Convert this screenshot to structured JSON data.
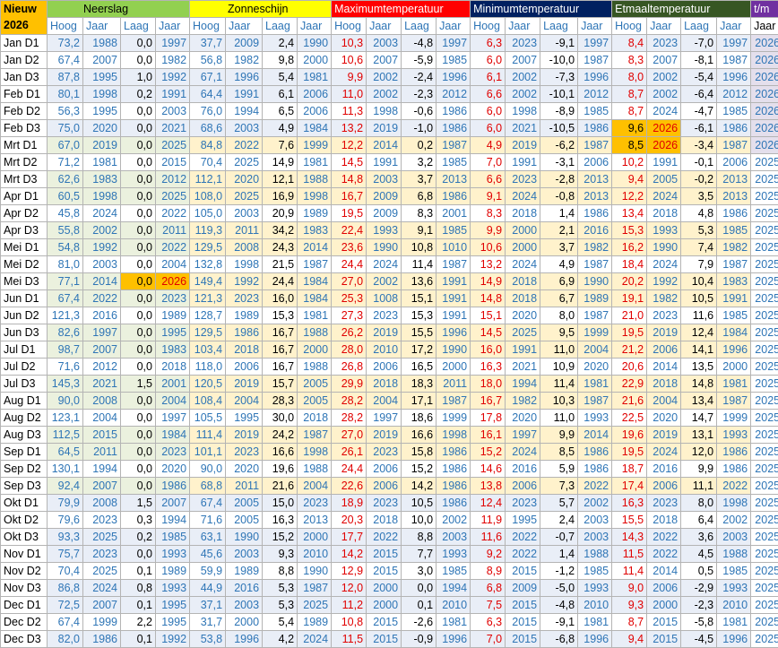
{
  "corner": {
    "line1": "Nieuw",
    "line2": "2026"
  },
  "groups": {
    "neerslag": "Neerslag",
    "zonneschijn": "Zonneschijn",
    "maxtemp": "Maximumtemperatuur",
    "mintemp": "Minimumtemperatuur",
    "etmaal": "Etmaaltemperatuur",
    "tm": "t/m"
  },
  "subheaders": [
    "Hoog",
    "Jaar",
    "Laag",
    "Jaar",
    "Hoog",
    "Jaar",
    "Laag",
    "Jaar",
    "Hoog",
    "Jaar",
    "Laag",
    "Jaar",
    "Hoog",
    "Jaar",
    "Laag",
    "Jaar",
    "Hoog",
    "Jaar",
    "Laag",
    "Jaar",
    "Jaar"
  ],
  "colors": {
    "highlight": "#ffc000",
    "blue_text": "#2e75b6",
    "red_text": "#e00000",
    "neerslag": "#92d050",
    "zon": "#ffff00",
    "max": "#ff0000",
    "min": "#002060",
    "etmaal": "#375623",
    "tm": "#7030a0"
  },
  "rows": [
    {
      "label": "Jan D1",
      "v": [
        "73,2",
        "1988",
        "0,0",
        "1997",
        "37,7",
        "2009",
        "2,4",
        "1990",
        "10,3",
        "2003",
        "-4,8",
        "1997",
        "6,3",
        "2023",
        "-9,1",
        "1997",
        "8,4",
        "2023",
        "-7,0",
        "1997",
        "2026"
      ]
    },
    {
      "label": "Jan D2",
      "v": [
        "67,4",
        "2007",
        "0,0",
        "1982",
        "56,8",
        "1982",
        "9,8",
        "2000",
        "10,6",
        "2007",
        "-5,9",
        "1985",
        "6,0",
        "2007",
        "-10,0",
        "1987",
        "8,3",
        "2007",
        "-8,1",
        "1987",
        "2026"
      ]
    },
    {
      "label": "Jan D3",
      "v": [
        "87,8",
        "1995",
        "1,0",
        "1992",
        "67,1",
        "1996",
        "5,4",
        "1981",
        "9,9",
        "2002",
        "-2,4",
        "1996",
        "6,1",
        "2002",
        "-7,3",
        "1996",
        "8,0",
        "2002",
        "-5,4",
        "1996",
        "2026"
      ]
    },
    {
      "label": "Feb D1",
      "v": [
        "80,1",
        "1998",
        "0,2",
        "1991",
        "64,4",
        "1991",
        "6,1",
        "2006",
        "11,0",
        "2002",
        "-2,3",
        "2012",
        "6,6",
        "2002",
        "-10,1",
        "2012",
        "8,7",
        "2002",
        "-6,4",
        "2012",
        "2026"
      ]
    },
    {
      "label": "Feb D2",
      "v": [
        "56,3",
        "1995",
        "0,0",
        "2003",
        "76,0",
        "1994",
        "6,5",
        "2006",
        "11,3",
        "1998",
        "-0,6",
        "1986",
        "6,0",
        "1998",
        "-8,9",
        "1985",
        "8,7",
        "2024",
        "-4,7",
        "1985",
        "2026"
      ]
    },
    {
      "label": "Feb D3",
      "v": [
        "75,0",
        "2020",
        "0,0",
        "2021",
        "68,6",
        "2003",
        "4,9",
        "1984",
        "13,2",
        "2019",
        "-1,0",
        "1986",
        "6,0",
        "2021",
        "-10,5",
        "1986",
        "9,6",
        "2026",
        "-6,1",
        "1986",
        "2026"
      ]
    },
    {
      "label": "Mrt D1",
      "v": [
        "67,0",
        "2019",
        "0,0",
        "2025",
        "84,8",
        "2022",
        "7,6",
        "1999",
        "12,2",
        "2014",
        "0,2",
        "1987",
        "4,9",
        "2019",
        "-6,2",
        "1987",
        "8,5",
        "2026",
        "-3,4",
        "1987",
        "2026"
      ]
    },
    {
      "label": "Mrt D2",
      "v": [
        "71,2",
        "1981",
        "0,0",
        "2015",
        "70,4",
        "2025",
        "14,9",
        "1981",
        "14,5",
        "1991",
        "3,2",
        "1985",
        "7,0",
        "1991",
        "-3,1",
        "2006",
        "10,2",
        "1991",
        "-0,1",
        "2006",
        "2025"
      ]
    },
    {
      "label": "Mrt D3",
      "v": [
        "62,6",
        "1983",
        "0,0",
        "2012",
        "112,1",
        "2020",
        "12,1",
        "1988",
        "14,8",
        "2003",
        "3,7",
        "2013",
        "6,6",
        "2023",
        "-2,8",
        "2013",
        "9,4",
        "2005",
        "-0,2",
        "2013",
        "2025"
      ]
    },
    {
      "label": "Apr D1",
      "v": [
        "60,5",
        "1998",
        "0,0",
        "2025",
        "108,0",
        "2025",
        "16,9",
        "1998",
        "16,7",
        "2009",
        "6,8",
        "1986",
        "9,1",
        "2024",
        "-0,8",
        "2013",
        "12,2",
        "2024",
        "3,5",
        "2013",
        "2025"
      ]
    },
    {
      "label": "Apr D2",
      "v": [
        "45,8",
        "2024",
        "0,0",
        "2022",
        "105,0",
        "2003",
        "20,9",
        "1989",
        "19,5",
        "2009",
        "8,3",
        "2001",
        "8,3",
        "2018",
        "1,4",
        "1986",
        "13,4",
        "2018",
        "4,8",
        "1986",
        "2025"
      ]
    },
    {
      "label": "Apr D3",
      "v": [
        "55,8",
        "2002",
        "0,0",
        "2011",
        "119,3",
        "2011",
        "34,2",
        "1983",
        "22,4",
        "1993",
        "9,1",
        "1985",
        "9,9",
        "2000",
        "2,1",
        "2016",
        "15,3",
        "1993",
        "5,3",
        "1985",
        "2025"
      ]
    },
    {
      "label": "Mei D1",
      "v": [
        "54,8",
        "1992",
        "0,0",
        "2022",
        "129,5",
        "2008",
        "24,3",
        "2014",
        "23,6",
        "1990",
        "10,8",
        "1010",
        "10,6",
        "2000",
        "3,7",
        "1982",
        "16,2",
        "1990",
        "7,4",
        "1982",
        "2025"
      ]
    },
    {
      "label": "Mei D2",
      "v": [
        "81,0",
        "2003",
        "0,0",
        "2004",
        "132,8",
        "1998",
        "21,5",
        "1987",
        "24,4",
        "2024",
        "11,4",
        "1987",
        "13,2",
        "2024",
        "4,9",
        "1987",
        "18,4",
        "2024",
        "7,9",
        "1987",
        "2025"
      ]
    },
    {
      "label": "Mei D3",
      "v": [
        "77,1",
        "2014",
        "0,0",
        "2026",
        "149,4",
        "1992",
        "24,4",
        "1984",
        "27,0",
        "2002",
        "13,6",
        "1991",
        "14,9",
        "2018",
        "6,9",
        "1990",
        "20,2",
        "1992",
        "10,4",
        "1983",
        "2025"
      ]
    },
    {
      "label": "Jun D1",
      "v": [
        "67,4",
        "2022",
        "0,0",
        "2023",
        "121,3",
        "2023",
        "16,0",
        "1984",
        "25,3",
        "1008",
        "15,1",
        "1991",
        "14,8",
        "2018",
        "6,7",
        "1989",
        "19,1",
        "1982",
        "10,5",
        "1991",
        "2025"
      ]
    },
    {
      "label": "Jun D2",
      "v": [
        "121,3",
        "2016",
        "0,0",
        "1989",
        "128,7",
        "1989",
        "15,3",
        "1981",
        "27,3",
        "2023",
        "15,3",
        "1991",
        "15,1",
        "2020",
        "8,0",
        "1987",
        "21,0",
        "2023",
        "11,6",
        "1985",
        "2025"
      ]
    },
    {
      "label": "Jun D3",
      "v": [
        "82,6",
        "1997",
        "0,0",
        "1995",
        "129,5",
        "1986",
        "16,7",
        "1988",
        "26,2",
        "2019",
        "15,5",
        "1996",
        "14,5",
        "2025",
        "9,5",
        "1999",
        "19,5",
        "2019",
        "12,4",
        "1984",
        "2025"
      ]
    },
    {
      "label": "Jul D1",
      "v": [
        "98,7",
        "2007",
        "0,0",
        "1983",
        "103,4",
        "2018",
        "16,7",
        "2000",
        "28,0",
        "2010",
        "17,2",
        "1990",
        "16,0",
        "1991",
        "11,0",
        "2004",
        "21,2",
        "2006",
        "14,1",
        "1996",
        "2025"
      ]
    },
    {
      "label": "Jul D2",
      "v": [
        "71,6",
        "2012",
        "0,0",
        "2018",
        "118,0",
        "2006",
        "16,7",
        "1988",
        "26,8",
        "2006",
        "16,5",
        "2000",
        "16,3",
        "2021",
        "10,9",
        "2020",
        "20,6",
        "2014",
        "13,5",
        "2000",
        "2025"
      ]
    },
    {
      "label": "Jul D3",
      "v": [
        "145,3",
        "2021",
        "1,5",
        "2001",
        "120,5",
        "2019",
        "15,7",
        "2005",
        "29,9",
        "2018",
        "18,3",
        "2011",
        "18,0",
        "1994",
        "11,4",
        "1981",
        "22,9",
        "2018",
        "14,8",
        "1981",
        "2025"
      ]
    },
    {
      "label": "Aug D1",
      "v": [
        "90,0",
        "2008",
        "0,0",
        "2004",
        "108,4",
        "2004",
        "28,3",
        "2005",
        "28,2",
        "2004",
        "17,1",
        "1987",
        "16,7",
        "1982",
        "10,3",
        "1987",
        "21,6",
        "2004",
        "13,4",
        "1987",
        "2025"
      ]
    },
    {
      "label": "Aug D2",
      "v": [
        "123,1",
        "2004",
        "0,0",
        "1997",
        "105,5",
        "1995",
        "30,0",
        "2018",
        "28,2",
        "1997",
        "18,6",
        "1999",
        "17,8",
        "2020",
        "11,0",
        "1993",
        "22,5",
        "2020",
        "14,7",
        "1999",
        "2025"
      ]
    },
    {
      "label": "Aug D3",
      "v": [
        "112,5",
        "2015",
        "0,0",
        "1984",
        "111,4",
        "2019",
        "24,2",
        "1987",
        "27,0",
        "2019",
        "16,6",
        "1998",
        "16,1",
        "1997",
        "9,9",
        "2014",
        "19,6",
        "2019",
        "13,1",
        "1993",
        "2025"
      ]
    },
    {
      "label": "Sep D1",
      "v": [
        "64,5",
        "2011",
        "0,0",
        "2023",
        "101,1",
        "2023",
        "16,6",
        "1998",
        "26,1",
        "2023",
        "15,8",
        "1986",
        "15,2",
        "2024",
        "8,5",
        "1986",
        "19,5",
        "2024",
        "12,0",
        "1986",
        "2025"
      ]
    },
    {
      "label": "Sep D2",
      "v": [
        "130,1",
        "1994",
        "0,0",
        "2020",
        "90,0",
        "2020",
        "19,6",
        "1988",
        "24,4",
        "2006",
        "15,2",
        "1986",
        "14,6",
        "2016",
        "5,9",
        "1986",
        "18,7",
        "2016",
        "9,9",
        "1986",
        "2025"
      ]
    },
    {
      "label": "Sep D3",
      "v": [
        "92,4",
        "2007",
        "0,0",
        "1986",
        "68,8",
        "2011",
        "21,6",
        "2004",
        "22,6",
        "2006",
        "14,2",
        "1986",
        "13,8",
        "2006",
        "7,3",
        "2022",
        "17,4",
        "2006",
        "11,1",
        "2022",
        "2025"
      ]
    },
    {
      "label": "Okt D1",
      "v": [
        "79,9",
        "2008",
        "1,5",
        "2007",
        "67,4",
        "2005",
        "15,0",
        "2023",
        "18,9",
        "2023",
        "10,5",
        "1986",
        "12,4",
        "2023",
        "5,7",
        "2002",
        "16,3",
        "2023",
        "8,0",
        "1998",
        "2025"
      ]
    },
    {
      "label": "Okt D2",
      "v": [
        "79,6",
        "2023",
        "0,3",
        "1994",
        "71,6",
        "2005",
        "16,3",
        "2013",
        "20,3",
        "2018",
        "10,0",
        "2002",
        "11,9",
        "1995",
        "2,4",
        "2003",
        "15,5",
        "2018",
        "6,4",
        "2002",
        "2025"
      ]
    },
    {
      "label": "Okt D3",
      "v": [
        "93,3",
        "2025",
        "0,2",
        "1985",
        "63,1",
        "1990",
        "15,2",
        "2000",
        "17,7",
        "2022",
        "8,8",
        "2003",
        "11,6",
        "2022",
        "-0,7",
        "2003",
        "14,3",
        "2022",
        "3,6",
        "2003",
        "2025"
      ]
    },
    {
      "label": "Nov D1",
      "v": [
        "75,7",
        "2023",
        "0,0",
        "1993",
        "45,6",
        "2003",
        "9,3",
        "2010",
        "14,2",
        "2015",
        "7,7",
        "1993",
        "9,2",
        "2022",
        "1,4",
        "1988",
        "11,5",
        "2022",
        "4,5",
        "1988",
        "2025"
      ]
    },
    {
      "label": "Nov D2",
      "v": [
        "70,4",
        "2025",
        "0,1",
        "1989",
        "59,9",
        "1989",
        "8,8",
        "1990",
        "12,9",
        "2015",
        "3,0",
        "1985",
        "8,9",
        "2015",
        "-1,2",
        "1985",
        "11,4",
        "2014",
        "0,5",
        "1985",
        "2025"
      ]
    },
    {
      "label": "Nov D3",
      "v": [
        "86,8",
        "2024",
        "0,8",
        "1993",
        "44,9",
        "2016",
        "5,3",
        "1987",
        "12,0",
        "2000",
        "0,0",
        "1994",
        "6,8",
        "2009",
        "-5,0",
        "1993",
        "9,0",
        "2006",
        "-2,9",
        "1993",
        "2025"
      ]
    },
    {
      "label": "Dec D1",
      "v": [
        "72,5",
        "2007",
        "0,1",
        "1995",
        "37,1",
        "2003",
        "5,3",
        "2025",
        "11,2",
        "2000",
        "0,1",
        "2010",
        "7,5",
        "2015",
        "-4,8",
        "2010",
        "9,3",
        "2000",
        "-2,3",
        "2010",
        "2025"
      ]
    },
    {
      "label": "Dec D2",
      "v": [
        "67,4",
        "1999",
        "2,2",
        "1995",
        "31,7",
        "2000",
        "5,4",
        "1989",
        "10,8",
        "2015",
        "-2,6",
        "1981",
        "6,3",
        "2015",
        "-9,1",
        "1981",
        "8,7",
        "2015",
        "-5,8",
        "1981",
        "2025"
      ]
    },
    {
      "label": "Dec D3",
      "v": [
        "82,0",
        "1986",
        "0,1",
        "1992",
        "53,8",
        "1996",
        "4,2",
        "2024",
        "11,5",
        "2015",
        "-0,9",
        "1996",
        "7,0",
        "2015",
        "-6,8",
        "1996",
        "9,4",
        "2015",
        "-4,5",
        "1996",
        "2025"
      ]
    }
  ]
}
